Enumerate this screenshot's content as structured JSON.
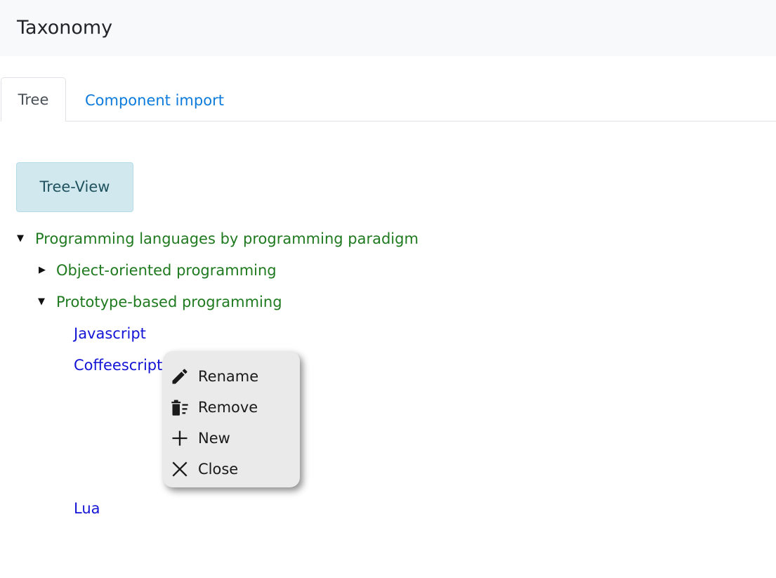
{
  "header": {
    "title": "Taxonomy"
  },
  "tabs": [
    {
      "label": "Tree",
      "active": true
    },
    {
      "label": "Component import",
      "active": false
    }
  ],
  "toolbar": {
    "tree_view_label": "Tree-View"
  },
  "tree": {
    "root": {
      "label": "Programming languages by programming paradigm",
      "expanded": true,
      "children": [
        {
          "label": "Object-oriented programming",
          "expanded": false
        },
        {
          "label": "Prototype-based programming",
          "expanded": true,
          "children": [
            {
              "label": "Javascript"
            },
            {
              "label": "Coffeescript"
            },
            {
              "label": "Lua"
            }
          ]
        }
      ]
    }
  },
  "context_menu": {
    "items": [
      {
        "label": "Rename",
        "icon": "pencil-icon"
      },
      {
        "label": "Remove",
        "icon": "trash-list-icon"
      },
      {
        "label": "New",
        "icon": "plus-icon"
      },
      {
        "label": "Close",
        "icon": "close-icon"
      }
    ]
  },
  "colors": {
    "category": "#1f7a1f",
    "leaf": "#1414d6",
    "tab_link": "#0d7bdc",
    "button_bg": "#d1e9ee"
  }
}
